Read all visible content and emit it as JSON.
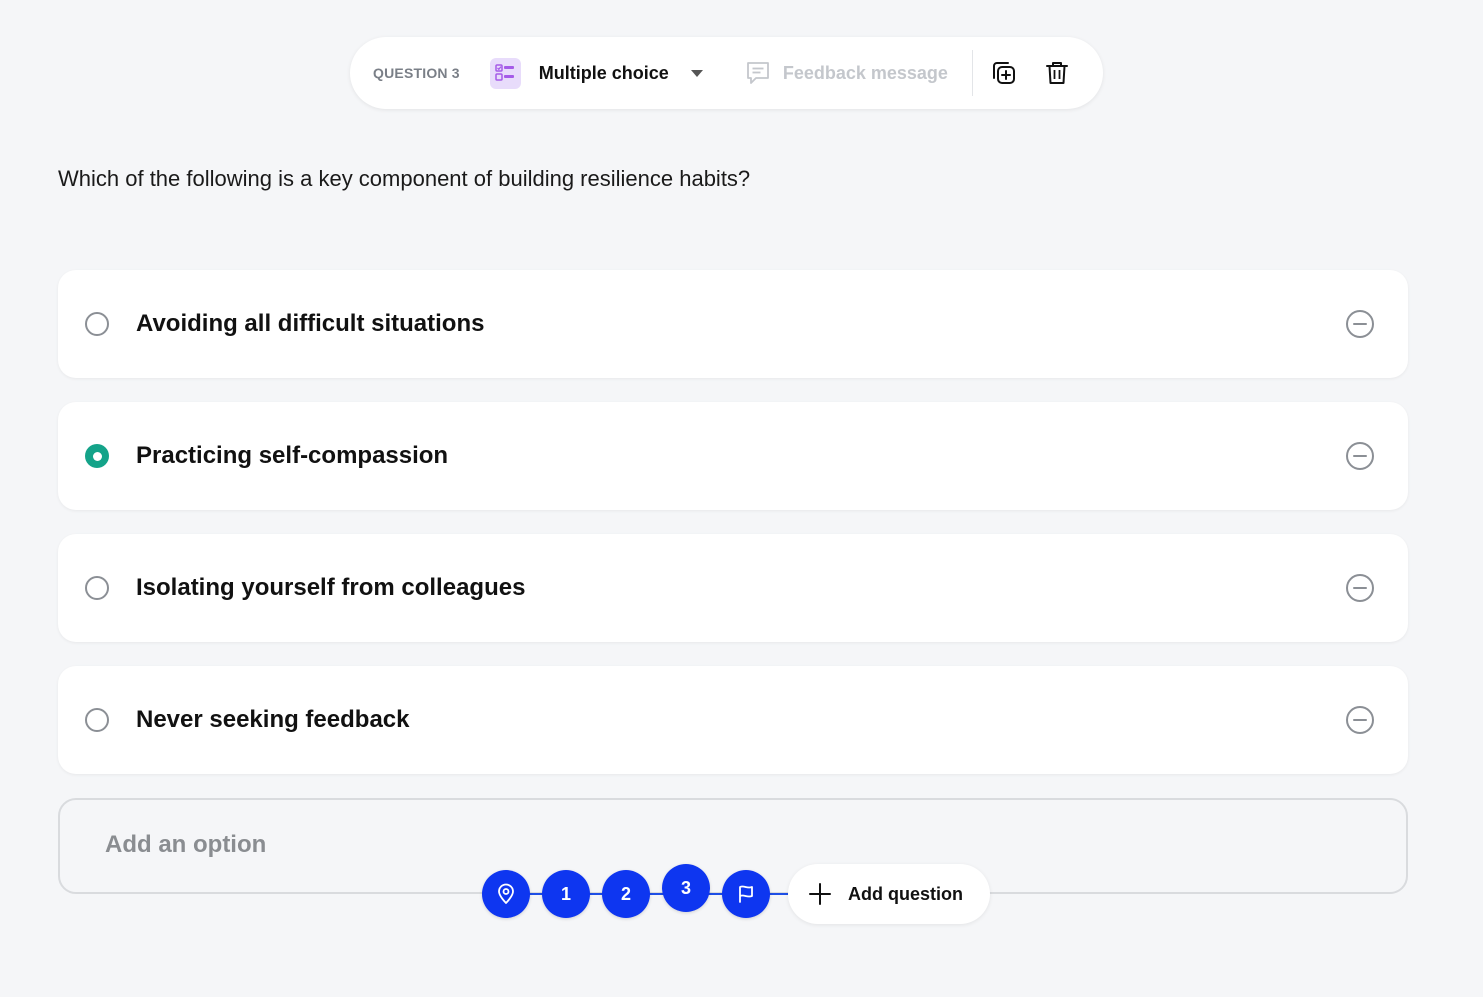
{
  "toolbar": {
    "question_label": "QUESTION 3",
    "type_label": "Multiple choice",
    "feedback_label": "Feedback message"
  },
  "question": {
    "text": "Which of the following is a key component of building resilience habits?"
  },
  "options": [
    {
      "label": "Avoiding all difficult situations",
      "selected": false
    },
    {
      "label": "Practicing self-compassion",
      "selected": true
    },
    {
      "label": "Isolating yourself from colleagues",
      "selected": false
    },
    {
      "label": "Never seeking feedback",
      "selected": false
    }
  ],
  "add_option": {
    "placeholder": "Add an option",
    "value": ""
  },
  "nav": {
    "steps": [
      "1",
      "2",
      "3"
    ],
    "current": "3",
    "add_question_label": "Add question"
  },
  "colors": {
    "accent_selected": "#14a389",
    "nav_blue": "#0e36f0",
    "type_icon_bg": "#e8dcfb",
    "background": "#f5f6f8"
  },
  "icons": {
    "type": "multiple-choice-icon",
    "feedback": "message-icon",
    "duplicate": "duplicate-icon",
    "delete": "trash-icon",
    "remove": "minus-circle-icon",
    "start": "location-pin-icon",
    "end": "flag-icon",
    "add": "plus-icon"
  }
}
